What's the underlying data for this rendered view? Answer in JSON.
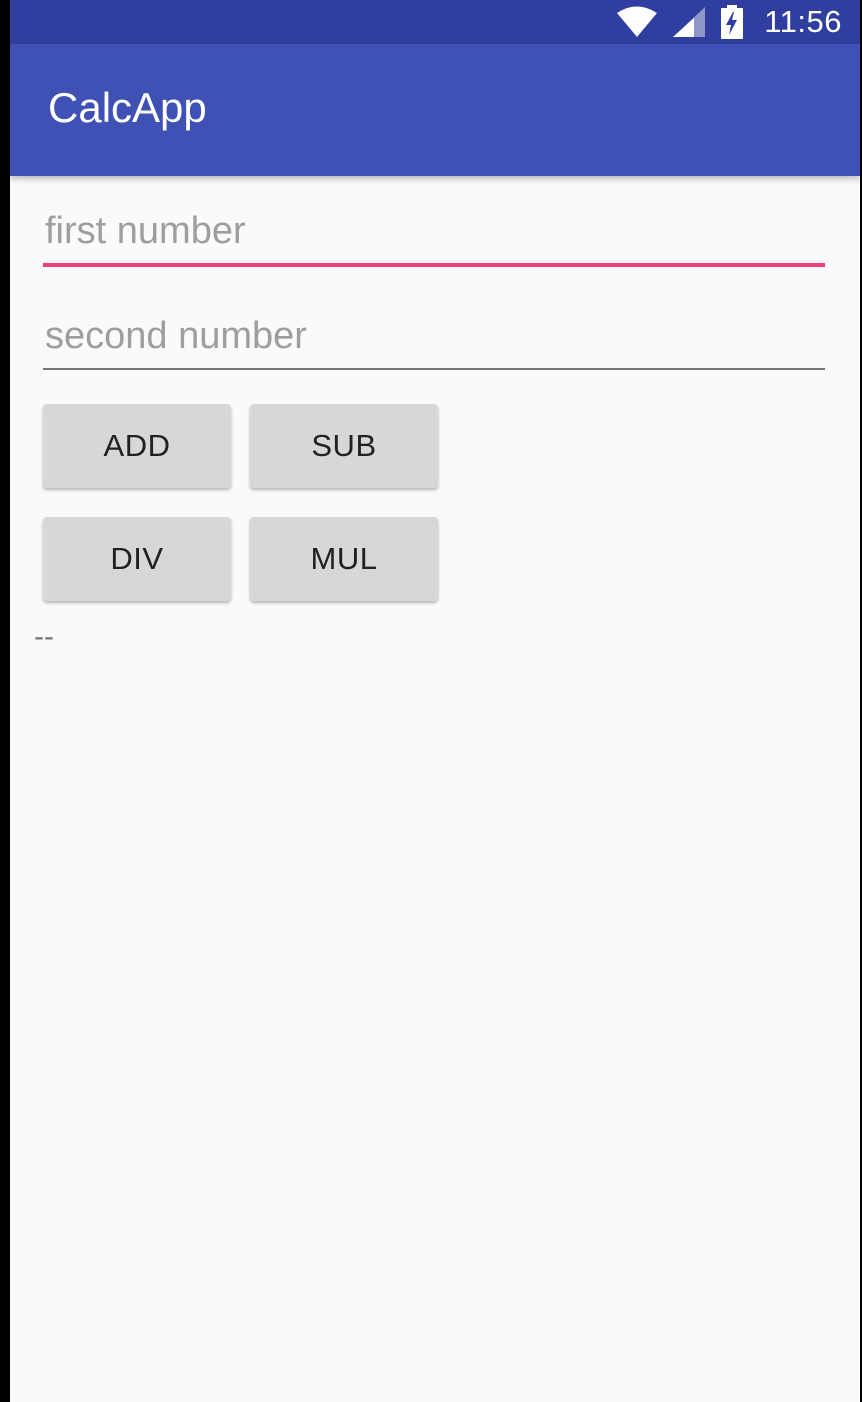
{
  "status_bar": {
    "time": "11:56",
    "icons": [
      "wifi-icon",
      "cell-signal-icon",
      "battery-charging-icon"
    ]
  },
  "app_bar": {
    "title": "CalcApp"
  },
  "inputs": {
    "first": {
      "value": "",
      "placeholder": "first number"
    },
    "second": {
      "value": "",
      "placeholder": "second number"
    }
  },
  "buttons": {
    "add": "ADD",
    "sub": "SUB",
    "div": "DIV",
    "mul": "MUL"
  },
  "result": {
    "text": "--"
  },
  "colors": {
    "status_bar": "#303f9f",
    "primary": "#3f51b5",
    "accent": "#ec407a",
    "background": "#fafafa",
    "button": "#d6d7d7"
  }
}
